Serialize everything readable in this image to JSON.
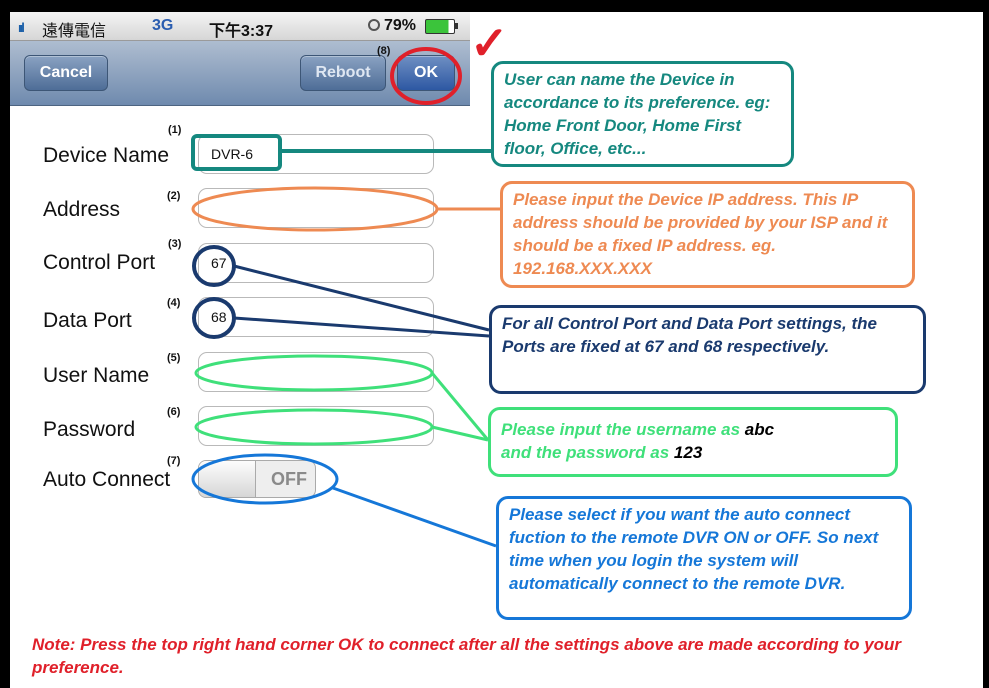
{
  "status_bar": {
    "signal": "ııl",
    "carrier": "遠傳電信",
    "network": "3G",
    "time": "下午3:37",
    "battery": "79%"
  },
  "nav": {
    "cancel": "Cancel",
    "reboot": "Reboot",
    "ok": "OK"
  },
  "form": {
    "fields": [
      {
        "num": "(1)",
        "label": "Device Name",
        "value": "DVR-6"
      },
      {
        "num": "(2)",
        "label": "Address",
        "value": ""
      },
      {
        "num": "(3)",
        "label": "Control Port",
        "value": "67"
      },
      {
        "num": "(4)",
        "label": "Data Port",
        "value": "68"
      },
      {
        "num": "(5)",
        "label": "User Name",
        "value": ""
      },
      {
        "num": "(6)",
        "label": "Password",
        "value": ""
      }
    ],
    "auto_connect": {
      "num": "(7)",
      "label": "Auto Connect",
      "state": "OFF"
    },
    "ok_num": "(8)",
    "check_mark": "✓"
  },
  "callouts": {
    "device_name": "User can name the Device in accordance to its preference. eg: Home Front Door, Home First floor, Office, etc...",
    "address": "Please input the Device IP address. This IP address should be provided by your ISP and it should be a fixed IP address. eg. 192.168.XXX.XXX",
    "ports": "For all Control Port and Data Port settings, the Ports are fixed at 67 and 68 respectively.",
    "credentials_prefix": "Please input the username as",
    "credentials_user": "abc",
    "credentials_mid": "and the password as",
    "credentials_pass": "123",
    "auto_connect": "Please select if you want the auto connect fuction to the remote DVR ON or OFF. So next time when you login the system will automatically connect to the remote DVR."
  },
  "note": "Note: Press the top right hand corner OK to connect after all the settings above are made according to your preference.",
  "colors": {
    "teal": "#15887f",
    "orange": "#ee8a52",
    "navy": "#1a3a6e",
    "green": "#3fe07a",
    "blue": "#1577d8",
    "red": "#e0202a"
  }
}
